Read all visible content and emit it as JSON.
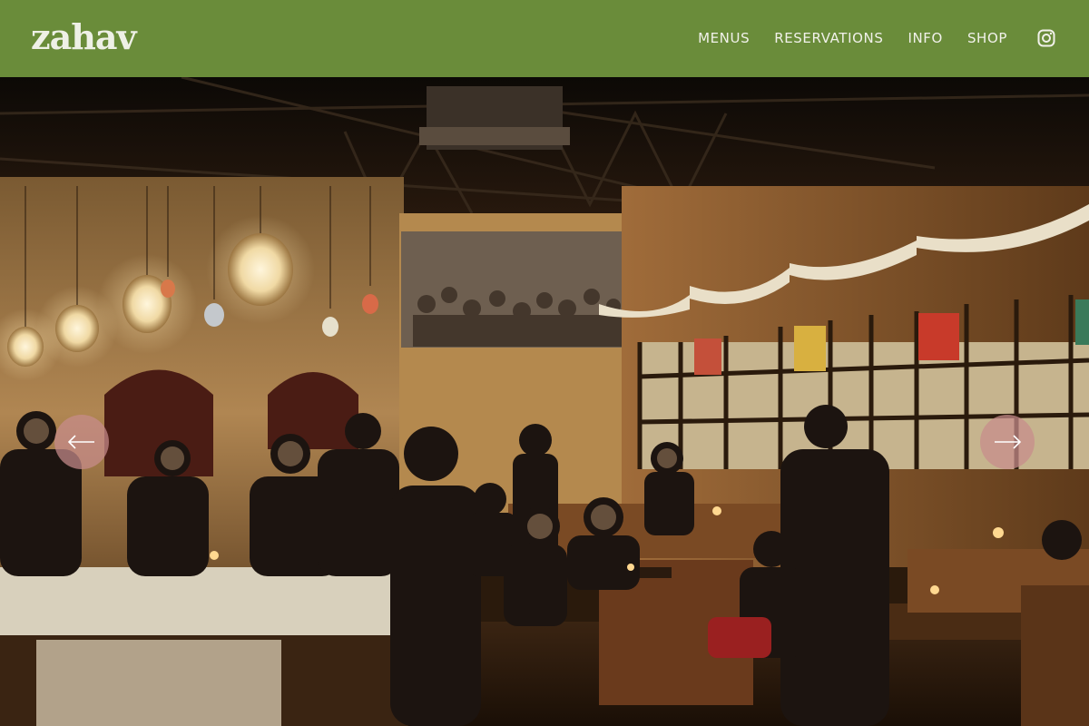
{
  "brand": {
    "logo_text": "zahav"
  },
  "nav": {
    "items": [
      {
        "label": "MENUS"
      },
      {
        "label": "RESERVATIONS"
      },
      {
        "label": "INFO"
      },
      {
        "label": "SHOP"
      }
    ],
    "social_icon": "instagram-icon"
  },
  "colors": {
    "header_bg": "#6a8c3a",
    "nav_text": "#f1f1ea",
    "arrow_bg": "#c88c8c"
  },
  "slider": {
    "prev_icon": "arrow-left-icon",
    "next_icon": "arrow-right-icon"
  }
}
